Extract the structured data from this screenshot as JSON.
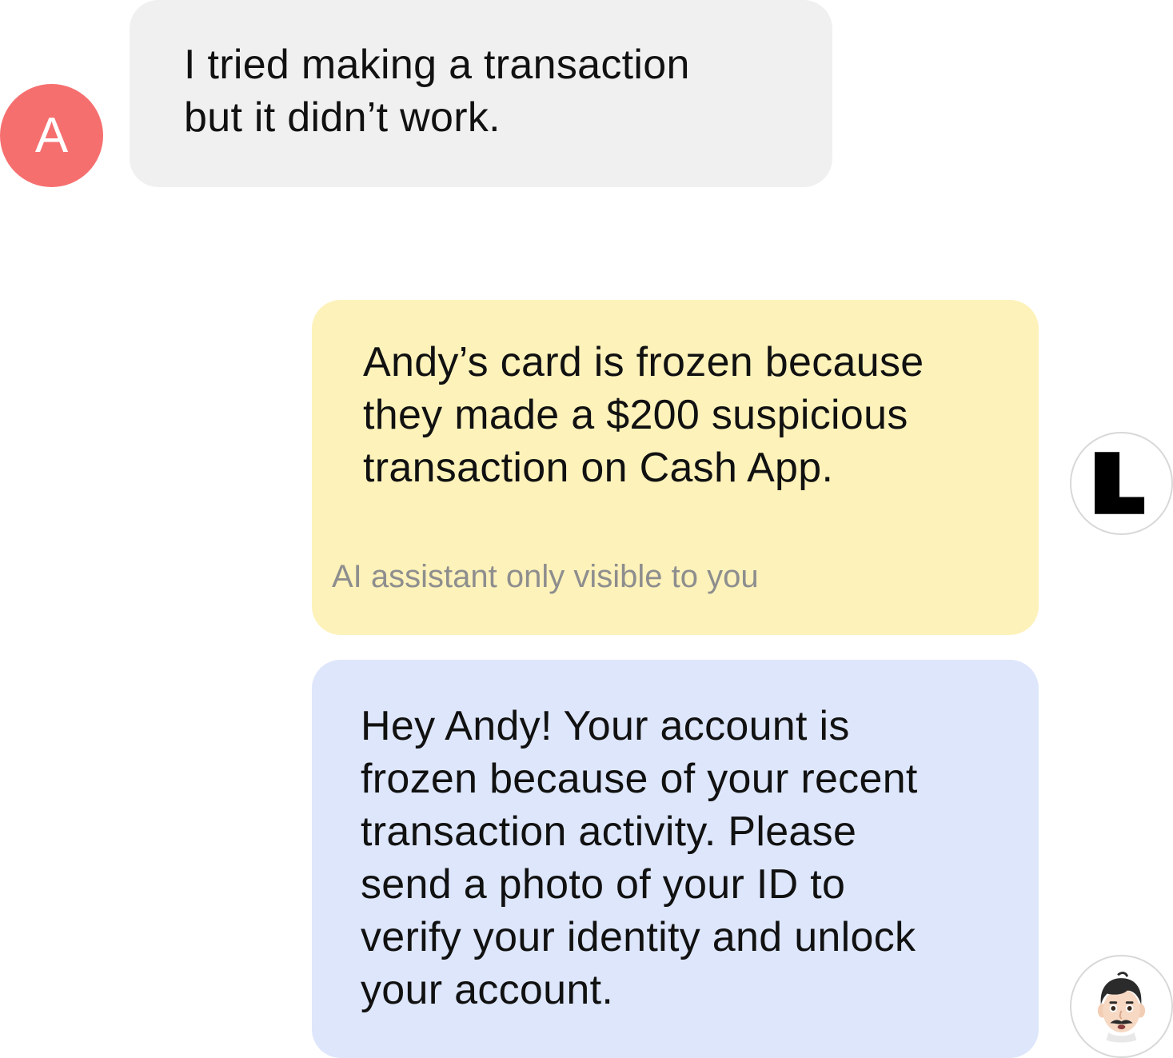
{
  "conversation": {
    "customer": {
      "avatar_letter": "A",
      "message": "I tried making a transaction\nbut it didn’t work."
    },
    "ai_assistant": {
      "avatar_icon": "l-logo-icon",
      "message": "Andy’s card is frozen because\nthey made a $200 suspicious\ntransaction on Cash App.",
      "visibility_note": "AI assistant only visible to you"
    },
    "agent": {
      "avatar_icon": "memoji-avatar-icon",
      "message": "Hey Andy! Your account is\nfrozen because of your recent\ntransaction activity. Please\nsend a photo of your ID to\nverify your identity and unlock\nyour account."
    }
  },
  "colors": {
    "customer_avatar": "#f66f6f",
    "customer_bubble": "#f0f0f0",
    "ai_bubble": "#fdf2ba",
    "agent_bubble": "#dde6fb",
    "note_text": "#8e8e8e"
  }
}
